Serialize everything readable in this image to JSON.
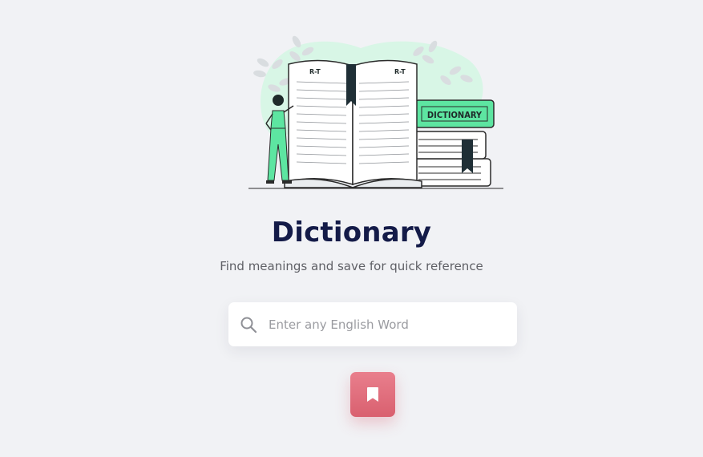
{
  "hero": {
    "book_page_label": "R-T",
    "book_cover_label": "DICTIONARY"
  },
  "header": {
    "title": "Dictionary",
    "subtitle": "Find meanings and save for quick reference"
  },
  "search": {
    "placeholder": "Enter any English Word",
    "value": "",
    "icon": "search-icon"
  },
  "saved_button": {
    "icon": "bookmark-icon"
  },
  "colors": {
    "background": "#f1f2f5",
    "title": "#141b48",
    "accent_green": "#5de5a1",
    "button_pink": "#e0707e"
  }
}
